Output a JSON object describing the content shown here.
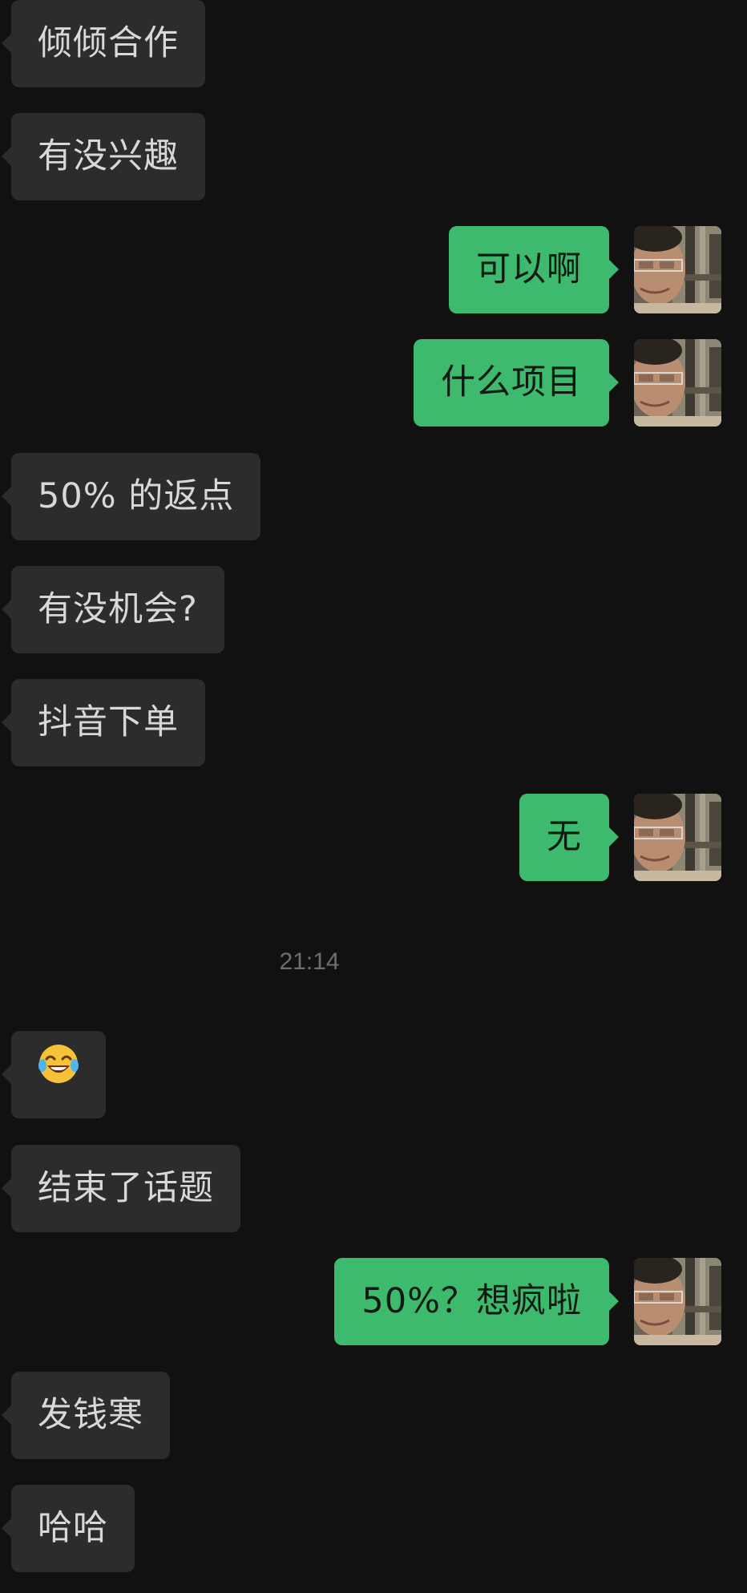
{
  "conversation": {
    "messages": [
      {
        "side": "in",
        "text": "倾倾合作"
      },
      {
        "side": "in",
        "text": "有没兴趣"
      },
      {
        "side": "out",
        "text": "可以啊"
      },
      {
        "side": "out",
        "text": "什么项目"
      },
      {
        "side": "in",
        "text": "50% 的返点"
      },
      {
        "side": "in",
        "text": "有没机会?"
      },
      {
        "side": "in",
        "text": "抖音下单"
      },
      {
        "side": "out",
        "text": "无"
      },
      {
        "side": "in",
        "text": "",
        "icon": "tears-of-joy-emoji-icon"
      },
      {
        "side": "in",
        "text": "结束了话题"
      },
      {
        "side": "out",
        "text": "50%？想疯啦"
      },
      {
        "side": "in",
        "text": "发钱寒"
      },
      {
        "side": "in",
        "text": "哈哈"
      }
    ],
    "timestamp": "21:14"
  },
  "colors": {
    "background": "#111111",
    "incoming_bubble": "#2c2c2c",
    "outgoing_bubble": "#3dba6d",
    "incoming_text": "#d8d8d8",
    "outgoing_text": "#0e1a12",
    "timestamp_text": "#6f6f6f"
  },
  "icons": {
    "avatar": "user-avatar-photo-icon",
    "emoji": "tears-of-joy-emoji-icon"
  }
}
